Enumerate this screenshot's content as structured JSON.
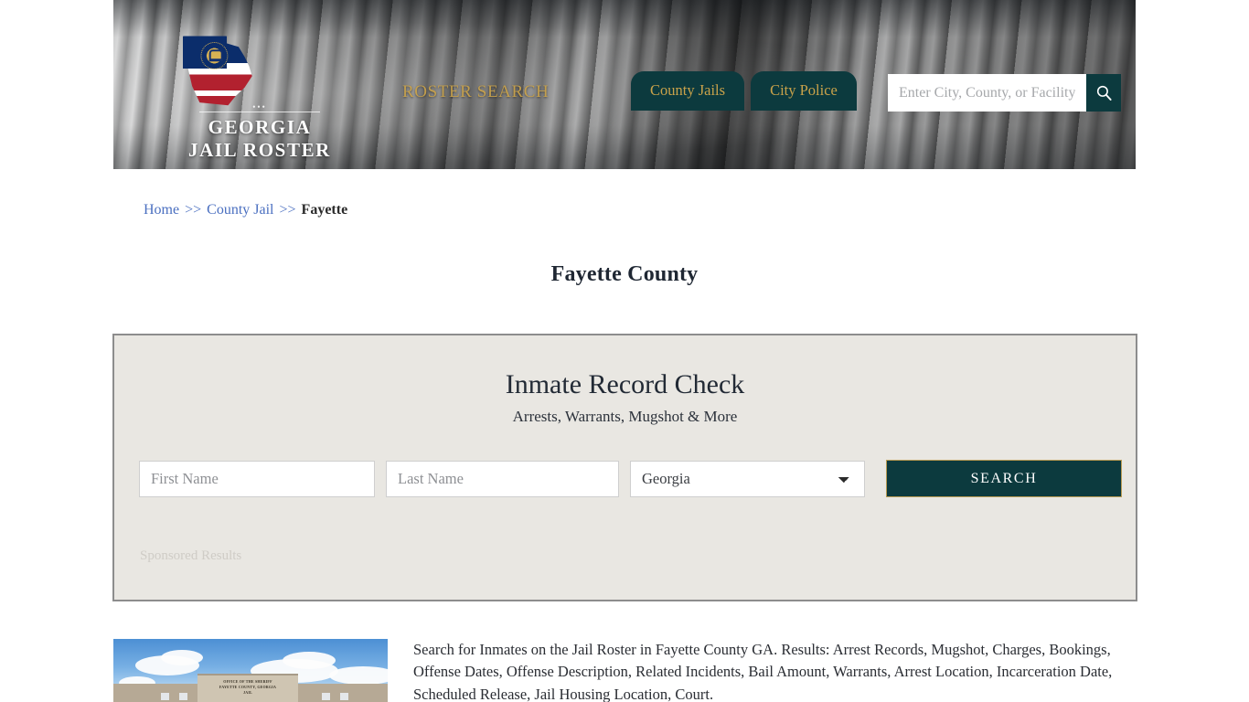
{
  "header": {
    "logo_name_line1": "GEORGIA",
    "logo_name_line2": "JAIL ROSTER",
    "tagline": "ROSTER SEARCH",
    "nav": [
      {
        "label": "County Jails"
      },
      {
        "label": "City Police"
      }
    ],
    "search": {
      "placeholder": "Enter City, County, or Facility",
      "value": "",
      "button_icon": "search-icon"
    },
    "colors": {
      "nav_background": "#0c3a3e",
      "nav_text": "#c9a24a",
      "tagline": "#c9a24a"
    }
  },
  "breadcrumb": {
    "home": "Home",
    "sep1": ">>",
    "county_jail": "County Jail",
    "sep2": ">>",
    "current": "Fayette"
  },
  "page_title": "Fayette County",
  "record_check": {
    "title": "Inmate Record Check",
    "subtitle": "Arrests, Warrants, Mugshot & More",
    "first_name": {
      "placeholder": "First Name",
      "value": ""
    },
    "last_name": {
      "placeholder": "Last Name",
      "value": ""
    },
    "state": {
      "selected": "Georgia",
      "options": [
        "Georgia"
      ]
    },
    "search_button": "SEARCH",
    "sponsored_label": "Sponsored Results",
    "colors": {
      "panel_background": "#e9e7e2",
      "panel_border": "#8d8d8d",
      "button_background": "#0c3a3e",
      "button_border": "#b99b53"
    }
  },
  "content": {
    "image": {
      "alt": "Fayette County Georgia Sheriff Office Jail building",
      "sign_line1": "OFFICE OF THE SHERIFF",
      "sign_line2": "FAYETTE COUNTY, GEORGIA",
      "sign_line3": "JAIL"
    },
    "description": "Search for Inmates on the Jail Roster in Fayette County GA. Results: Arrest Records, Mugshot, Charges, Bookings, Offense Dates, Offense Description, Related Incidents, Bail Amount, Warrants, Arrest Location, Incarceration Date, Scheduled Release, Jail Housing Location, Court."
  }
}
